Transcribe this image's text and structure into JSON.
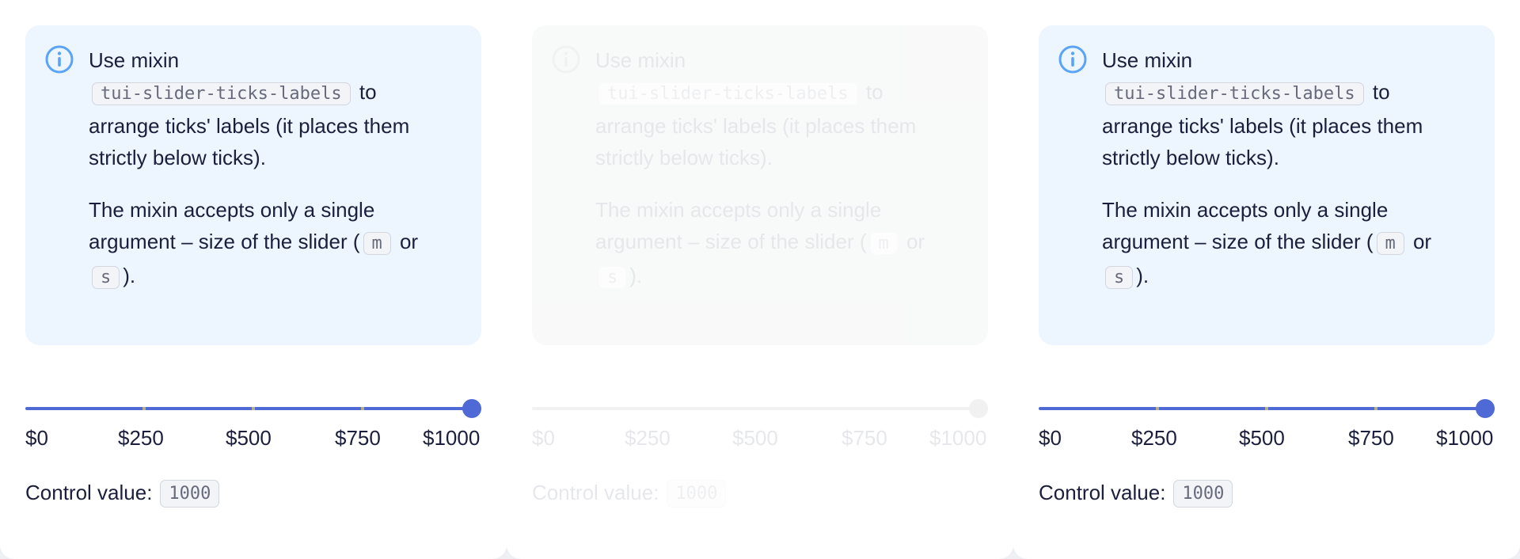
{
  "colors": {
    "accent": "#4f6ad6",
    "notice_background": "#edf5ff",
    "info_icon": "#5aa4f5",
    "text": "#1b1f3b"
  },
  "notice": {
    "icon": "info-icon",
    "line_1_text": "Use mixin",
    "mixin_name": "tui-slider-ticks-labels",
    "line_2_suffix": " to",
    "line_3_text": "arrange ticks' labels (it places them strictly below ticks).",
    "para_2_text": "The mixin accepts only a single argument – size of the slider (",
    "size_m": "m",
    "or_text": " or ",
    "size_s": "s",
    "para_2_end": ")."
  },
  "slider": {
    "tick_labels": [
      "$0",
      "$250",
      "$500",
      "$750",
      "$1000"
    ],
    "min": 0,
    "max": 1000,
    "value": 1000
  },
  "control": {
    "label": "Control value:",
    "value": "1000"
  },
  "panels": [
    {
      "state": "enabled"
    },
    {
      "state": "disabled"
    },
    {
      "state": "enabled"
    }
  ]
}
